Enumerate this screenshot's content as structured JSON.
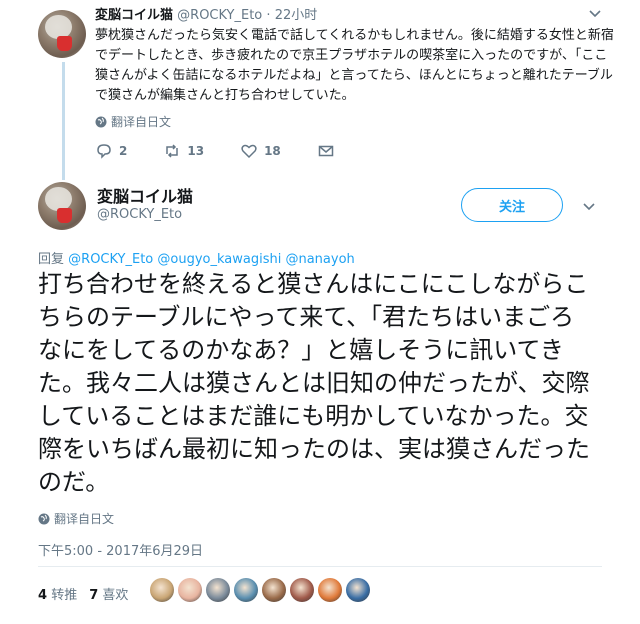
{
  "tweet1": {
    "name": "変脳コイル猫",
    "handle": "@ROCKY_Eto",
    "separator": "·",
    "time": "22小时",
    "text": "夢枕獏さんだったら気安く電話で話してくれるかもしれません。後に結婚する女性と新宿でデートしたとき、歩き疲れたので京王プラザホテルの喫茶室に入ったのですが、「ここ獏さんがよく缶詰になるホテルだよね」と言ってたら、ほんとにちょっと離れたテーブルで獏さんが編集さんと打ち合わせしていた。",
    "translate": "翻译自日文",
    "replies": "2",
    "retweets": "13",
    "likes": "18"
  },
  "tweet2": {
    "name": "変脳コイル猫",
    "handle": "@ROCKY_Eto",
    "follow": "关注",
    "reply_label": "回复",
    "mentions": "@ROCKY_Eto @ougyo_kawagishi @nanayoh",
    "text": "打ち合わせを終えると獏さんはにこにこしながらこちらのテーブルにやって来て、「君たちはいまごろなにをしてるのかなあ？」と嬉しそうに訊いてきた。我々二人は獏さんとは旧知の仲だったが、交際していることはまだ誰にも明かしていなかった。交際をいちばん最初に知ったのは、実は獏さんだったのだ。",
    "translate": "翻译自日文",
    "timestamp": "下午5:00 - 2017年6月29日",
    "retweet_count": "4",
    "retweet_label": "转推",
    "like_count": "7",
    "like_label": "喜欢"
  },
  "colors": {
    "accent": "#1da1f2",
    "muted": "#657786",
    "thread": "#c4dcec"
  },
  "likers": [
    "#c9a574",
    "#e8b4a0",
    "#7a8a9a",
    "#5a8fb0",
    "#9a6b4a",
    "#a05a4a",
    "#e07a3a",
    "#3a6ea5"
  ]
}
